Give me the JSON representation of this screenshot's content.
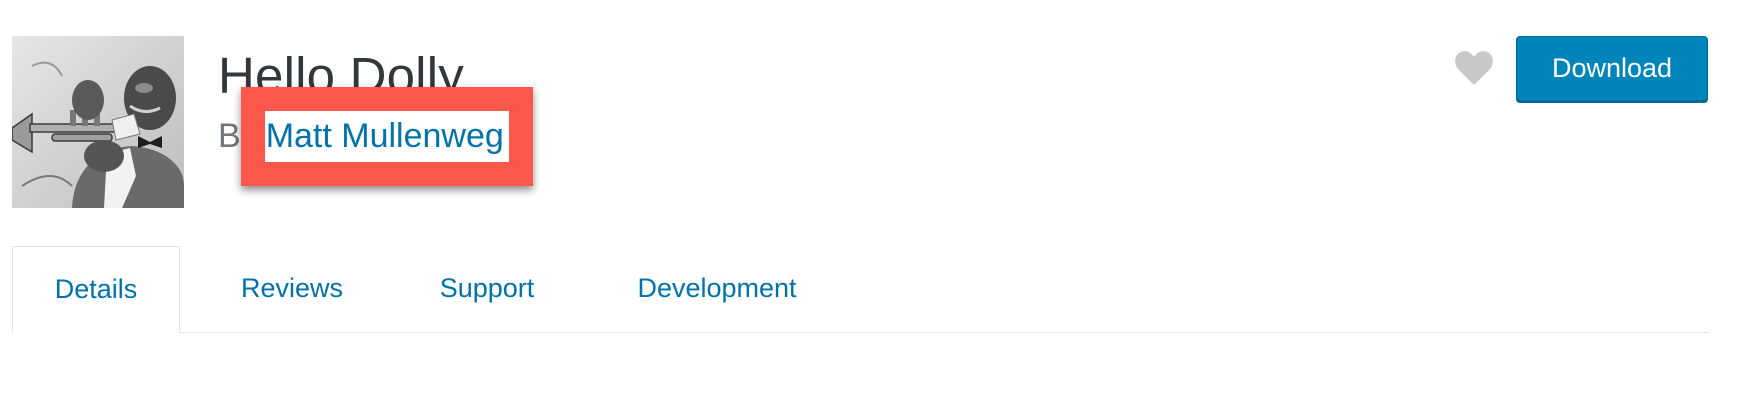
{
  "plugin": {
    "title": "Hello Dolly",
    "by_prefix": "By",
    "author": "Matt Mullenweg",
    "icon": "trumpet-player-portrait"
  },
  "actions": {
    "favorite_icon": "heart-icon",
    "download_label": "Download"
  },
  "tabs": [
    {
      "label": "Details",
      "active": true
    },
    {
      "label": "Reviews",
      "active": false
    },
    {
      "label": "Support",
      "active": false
    },
    {
      "label": "Development",
      "active": false
    }
  ],
  "colors": {
    "link": "#0073aa",
    "download_bg": "#0085ba",
    "highlight": "#fb574b",
    "favorite": "#c8c8c8"
  }
}
